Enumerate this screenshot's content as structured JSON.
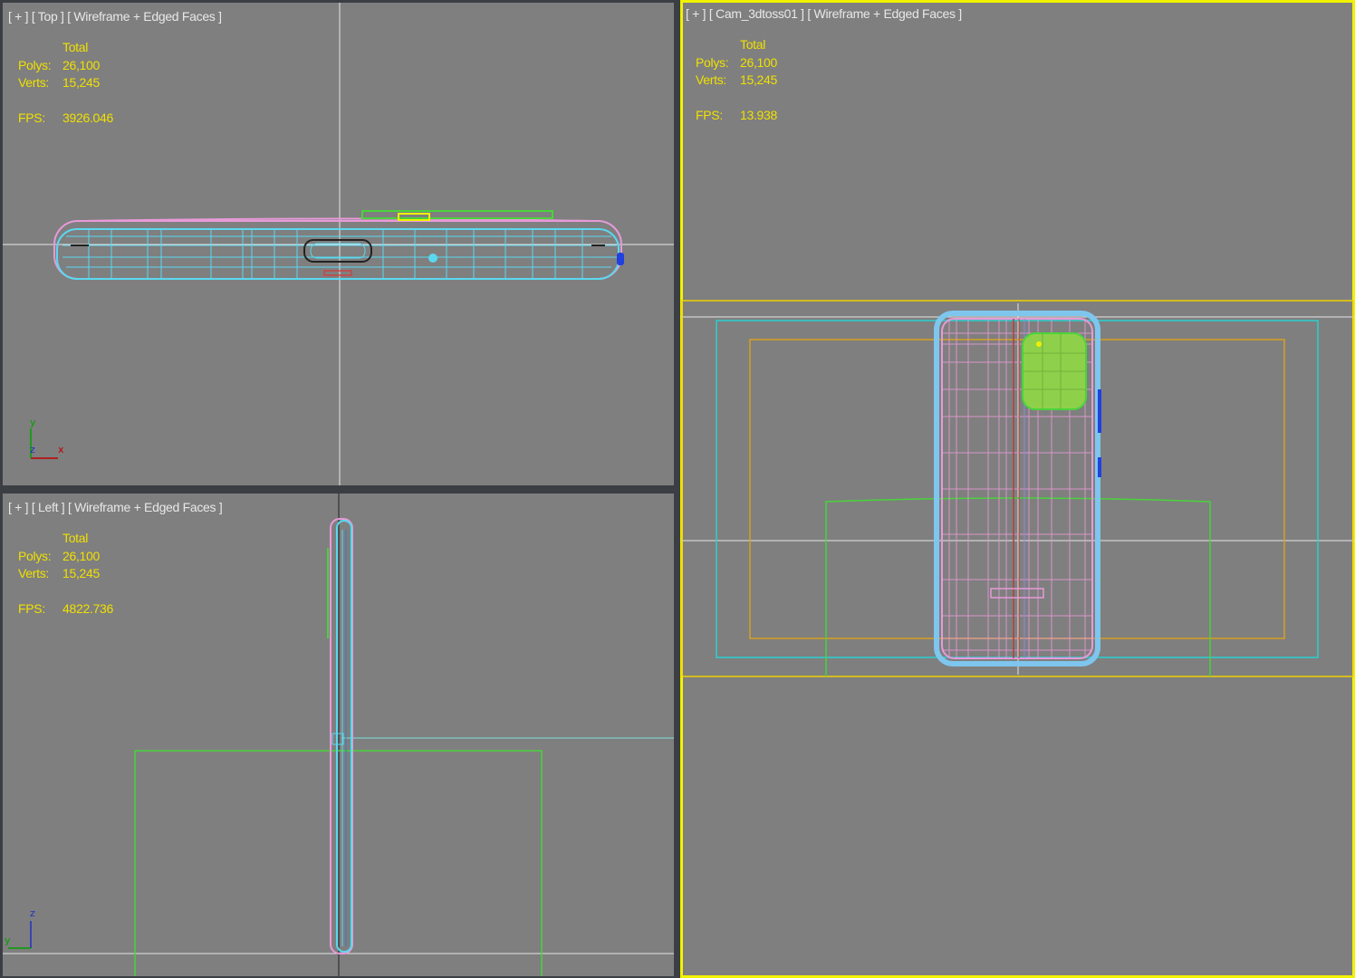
{
  "viewports": {
    "top": {
      "label_plus": "[ + ]",
      "label_view": "[ Top ]",
      "label_mode": "[ Wireframe + Edged Faces ]",
      "stats": {
        "total": "Total",
        "polys_k": "Polys:",
        "polys_v": "26,100",
        "verts_k": "Verts:",
        "verts_v": "15,245",
        "fps_k": "FPS:",
        "fps_v": "3926.046"
      },
      "axes": {
        "a": "y",
        "b": "x",
        "c": "z"
      }
    },
    "left": {
      "label_plus": "[ + ]",
      "label_view": "[ Left ]",
      "label_mode": "[ Wireframe + Edged Faces ]",
      "stats": {
        "total": "Total",
        "polys_k": "Polys:",
        "polys_v": "26,100",
        "verts_k": "Verts:",
        "verts_v": "15,245",
        "fps_k": "FPS:",
        "fps_v": "4822.736"
      },
      "axes": {
        "a": "z",
        "b": "y"
      }
    },
    "camera": {
      "label_plus": "[ + ]",
      "label_view": "[ Cam_3dtoss01 ]",
      "label_mode": "[ Wireframe + Edged Faces ]",
      "stats": {
        "total": "Total",
        "polys_k": "Polys:",
        "polys_v": "26,100",
        "verts_k": "Verts:",
        "verts_v": "15,245",
        "fps_k": "FPS:",
        "fps_v": "13.938"
      },
      "active": true
    }
  },
  "colors": {
    "viewport_bg": "#7f7f7f",
    "active_border": "#f2f200",
    "stats_text": "#f0e000",
    "wire_cyan": "#5ad8f0",
    "wire_pink": "#e79ad8",
    "wire_green": "#49d43b",
    "safe_frame_orange": "#d7a020",
    "safe_frame_cyan": "#2ad0d0"
  }
}
